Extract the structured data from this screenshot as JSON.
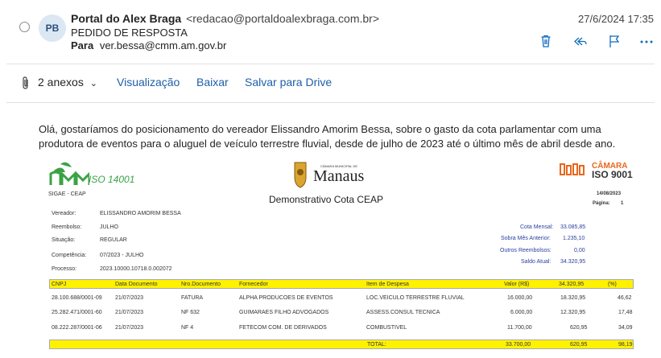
{
  "header": {
    "avatar_initials": "PB",
    "sender_name": "Portal do Alex Braga",
    "sender_email": "<redacao@portaldoalexbraga.com.br>",
    "subject": "PEDIDO DE RESPOSTA",
    "to_label": "Para",
    "to_value": "ver.bessa@cmm.am.gov.br",
    "date": "27/6/2024 17:35"
  },
  "attachments": {
    "count_label": "2 anexos",
    "view": "Visualização",
    "download": "Baixar",
    "save": "Salvar para Drive"
  },
  "message": "Olá, gostaríamos do posicionamento do vereador Elissandro Amorim Bessa, sobre o gasto da cota parlamentar com uma produtora de eventos para o aluguel de veículo terrestre fluvial, desde de julho de 2023 até o último mês de abril desde ano.",
  "document": {
    "iso_left": "ISO 14001",
    "sigae": "SIGAE - CEAP",
    "city_small": "CÂMARA MUNICIPAL DE",
    "city": "Manaus",
    "title": "Demonstrativo Cota CEAP",
    "camara": "CÂMARA",
    "iso_right": "ISO 9001",
    "date": "14/08/2023",
    "page_label": "Página:",
    "page_value": "1",
    "fields": [
      {
        "label": "Vereador:",
        "value": "ELISSANDRO AMORIM BESSA"
      },
      {
        "label": "Reembolso:",
        "value": "JULHO"
      },
      {
        "label": "Situação:",
        "value": "REGULAR"
      },
      {
        "label": "Competência:",
        "value": "07/2023   -   JULHO"
      },
      {
        "label": "Processo:",
        "value": "2023.10000.10718.0.002072"
      }
    ],
    "summary": [
      {
        "label": "Cota Mensal:",
        "value": "33.085,85"
      },
      {
        "label": "Sobra Mês Anterior:",
        "value": "1.235,10"
      },
      {
        "label": "Outros Reembolsos:",
        "value": "0,00"
      },
      {
        "label": "Saldo Atual:",
        "value": "34.320,95"
      }
    ],
    "columns": [
      "CNPJ",
      "Data Documento",
      "Nro.Documento",
      "Fornecedor",
      "Item de Despesa",
      "Valor (R$)",
      "34.320,95",
      "(%)"
    ],
    "rows": [
      [
        "28.100.688/0001-09",
        "21/07/2023",
        "FATURA",
        "ALPHA PRODUCOES DE EVENTOS",
        "LOC.VEICULO TERRESTRE FLUVIAL",
        "16.000,00",
        "18.320,95",
        "46,62"
      ],
      [
        "25.282.471/0001-60",
        "21/07/2023",
        "NF 632",
        "GUIMARAES FILHO ADVOGADOS",
        "ASSESS.CONSUL TECNICA",
        "6.000,00",
        "12.320,95",
        "17,48"
      ],
      [
        "08.222.287/0001-06",
        "21/07/2023",
        "NF 4",
        "FETECOM COM. DE DERIVADOS",
        "COMBUSTIVEL",
        "11.700,00",
        "620,95",
        "34,09"
      ]
    ],
    "total_label": "TOTAL:",
    "total_values": [
      "33.700,00",
      "620,95",
      "98,19"
    ]
  },
  "colors": {
    "link": "#1f5fa8",
    "accent": "#0f6cbd",
    "table_header": "#fff200"
  }
}
